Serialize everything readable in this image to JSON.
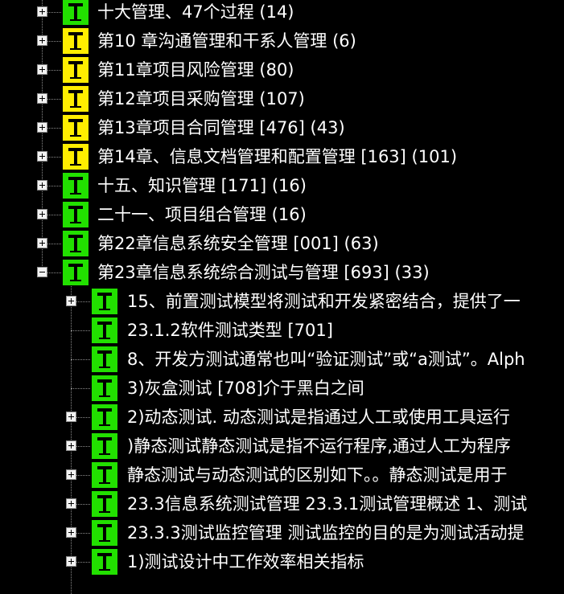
{
  "colors": {
    "background": "#000000",
    "icon_green": "#22e000",
    "icon_yellow": "#ffee00",
    "text": "#ffffff"
  },
  "icon_names": {
    "toggle_expand": "plus-box-icon",
    "toggle_collapse": "minus-box-icon",
    "node_icon": "text-t-icon"
  },
  "tree": {
    "level1": [
      {
        "label": "十大管理、47个过程 (14)",
        "icon_color": "green",
        "toggle": "plus"
      },
      {
        "label": "第10 章沟通管理和干系人管理 (6)",
        "icon_color": "yellow",
        "toggle": "plus"
      },
      {
        "label": "第11章项目风险管理 (80)",
        "icon_color": "yellow",
        "toggle": "plus"
      },
      {
        "label": "第12章项目采购管理 (107)",
        "icon_color": "yellow",
        "toggle": "plus"
      },
      {
        "label": "第13章项目合同管理 [476] (43)",
        "icon_color": "yellow",
        "toggle": "plus"
      },
      {
        "label": "第14章、信息文档管理和配置管理 [163] (101)",
        "icon_color": "yellow",
        "toggle": "plus"
      },
      {
        "label": "十五、知识管理 [171] (16)",
        "icon_color": "green",
        "toggle": "plus"
      },
      {
        "label": "二十一、项目组合管理 (16)",
        "icon_color": "green",
        "toggle": "plus"
      },
      {
        "label": "第22章信息系统安全管理 [001] (63)",
        "icon_color": "green",
        "toggle": "plus"
      },
      {
        "label": "第23章信息系统综合测试与管理 [693] (33)",
        "icon_color": "green",
        "toggle": "minus"
      }
    ],
    "level2": [
      {
        "label": "15、前置测试模型将测试和开发紧密结合，提供了一",
        "icon_color": "green",
        "toggle": "plus"
      },
      {
        "label": "23.1.2软件测试类型 [701]",
        "icon_color": "green",
        "toggle": "none"
      },
      {
        "label": "8、开发方测试通常也叫“验证测试”或“a测试”。Alph",
        "icon_color": "green",
        "toggle": "none"
      },
      {
        "label": "3)灰盒测试 [708]介于黑白之间",
        "icon_color": "green",
        "toggle": "none"
      },
      {
        "label": "2)动态测试. 动态测试是指通过人工或使用工具运行",
        "icon_color": "green",
        "toggle": "plus"
      },
      {
        "label": ")静态测试静态测试是指不运行程序,通过人工为程序",
        "icon_color": "green",
        "toggle": "plus"
      },
      {
        "label": "静态测试与动态测试的区别如下。。静态测试是用于",
        "icon_color": "green",
        "toggle": "plus"
      },
      {
        "label": "23.3信息系统测试管理 23.3.1测试管理概述 1、测试",
        "icon_color": "green",
        "toggle": "plus"
      },
      {
        "label": "23.3.3测试监控管理 测试监控的目的是为测试活动提",
        "icon_color": "green",
        "toggle": "plus"
      },
      {
        "label": "1)测试设计中工作效率相关指标",
        "icon_color": "green",
        "toggle": "plus"
      }
    ]
  }
}
